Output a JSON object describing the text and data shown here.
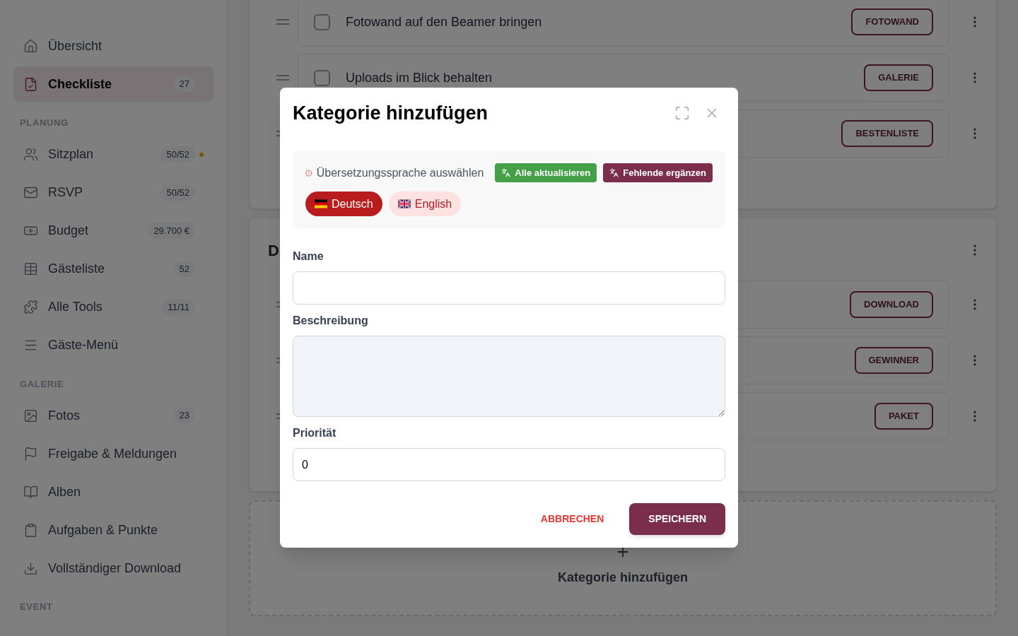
{
  "sidebar": {
    "top_items": [
      {
        "label": "Übersicht",
        "kind": "home",
        "selected": false,
        "indicator": false
      },
      {
        "label": "Checkliste",
        "kind": "checklist",
        "badge": "27",
        "selected": true,
        "indicator": false
      }
    ],
    "sections": [
      {
        "heading": "PLANUNG",
        "items": [
          {
            "label": "Sitzplan",
            "kind": "users",
            "badge": "50/52",
            "selected": false,
            "indicator": true
          },
          {
            "label": "RSVP",
            "kind": "mail",
            "badge": "50/52",
            "selected": false,
            "indicator": false
          },
          {
            "label": "Budget",
            "kind": "money",
            "badge": "29.700 €",
            "selected": false,
            "indicator": false
          },
          {
            "label": "Gästeliste",
            "kind": "table",
            "badge": "52",
            "selected": false,
            "indicator": false
          },
          {
            "label": "Alle Tools",
            "kind": "puzzle",
            "badge": "11/11",
            "selected": false,
            "indicator": false
          },
          {
            "label": "Gäste-Menü",
            "kind": "menu",
            "selected": false,
            "indicator": false
          }
        ]
      },
      {
        "heading": "GALERIE",
        "items": [
          {
            "label": "Fotos",
            "kind": "image",
            "badge": "23",
            "selected": false,
            "indicator": false
          },
          {
            "label": "Freigabe & Meldungen",
            "kind": "flag",
            "selected": false,
            "indicator": false
          },
          {
            "label": "Alben",
            "kind": "book",
            "selected": false,
            "indicator": false
          },
          {
            "label": "Aufgaben & Punkte",
            "kind": "clipboard",
            "selected": false,
            "indicator": false
          },
          {
            "label": "Vollständiger Download",
            "kind": "download",
            "selected": false,
            "indicator": false
          }
        ]
      },
      {
        "heading": "EVENT"
      }
    ]
  },
  "cards": [
    {
      "rows": [
        {
          "text": "Fotowand auf den Beamer bringen",
          "checked": false,
          "tag": "FOTOWAND"
        },
        {
          "text": "Uploads im Blick behalten",
          "checked": false,
          "tag": "GALERIE"
        },
        {
          "tag": "BESTENLISTE"
        }
      ]
    },
    {
      "title": "D",
      "rows": [
        {
          "tag": "DOWNLOAD"
        },
        {
          "tag": "GEWINNER"
        },
        {
          "tag": "PAKET"
        }
      ]
    }
  ],
  "add_category": {
    "label": "Kategorie hinzufügen"
  },
  "dialog": {
    "title": "Kategorie hinzufügen",
    "translation": {
      "message": "Übersetzungssprache auswählen",
      "actions": [
        {
          "label": "Alle aktualisieren",
          "kind": "update"
        },
        {
          "label": "Fehlende ergänzen",
          "kind": "fill"
        }
      ],
      "languages": [
        {
          "label": "Deutsch",
          "kind": "de",
          "selected": true
        },
        {
          "label": "English",
          "kind": "gb",
          "selected": false
        }
      ]
    },
    "fields": [
      {
        "label": "Name",
        "kind": "input"
      },
      {
        "label": "Beschreibung",
        "kind": "textarea"
      },
      {
        "label": "Priorität",
        "kind": "input",
        "value": "0"
      }
    ],
    "cancel": "ABBRECHEN",
    "save": "SPEICHERN"
  }
}
